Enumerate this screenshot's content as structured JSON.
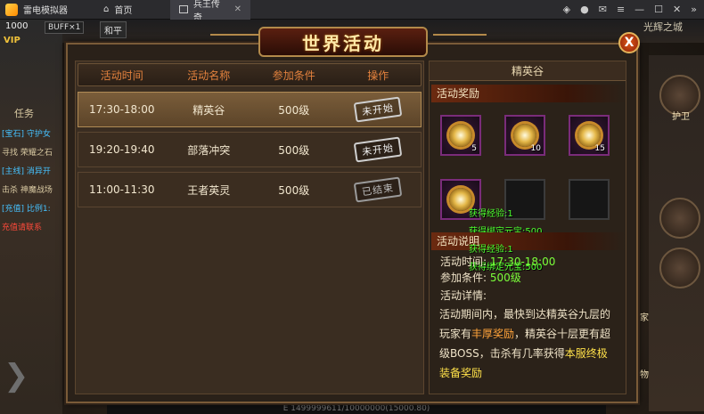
{
  "titlebar": {
    "app_name": "雷电模拟器",
    "tabs": [
      {
        "label": "首页"
      },
      {
        "label": "兵王传奇"
      }
    ],
    "icons": [
      "gamepad-icon",
      "user-icon",
      "mail-icon",
      "menu-icon",
      "minimize-icon",
      "maximize-icon",
      "close-icon",
      "expand-icon"
    ]
  },
  "hud": {
    "level": "1000",
    "vip": "VIP",
    "buff": "BUFF×1",
    "mode": "和平",
    "map_name": "光辉之城",
    "task_title": "任务",
    "task_lines": [
      {
        "text": "[宝石] 守护女",
        "color": "#46c2ff"
      },
      {
        "text": "寻找 荣耀之石",
        "color": "#d9c9a2"
      },
      {
        "text": "[主线] 消异开",
        "color": "#46c2ff"
      },
      {
        "text": "击杀 神魔战场",
        "color": "#d9c9a2"
      },
      {
        "text": "[充值] 比例1:",
        "color": "#46c2ff"
      },
      {
        "text": "充值请联系",
        "color": "#ff4a3a"
      }
    ],
    "side_labels": [
      "护卫",
      "玩家",
      "怪物"
    ],
    "bottom_text": "E 1499999611/10000000(15000.80)"
  },
  "dialog": {
    "title": "世界活动",
    "close_label": "X"
  },
  "activities": {
    "headers": [
      "活动时间",
      "活动名称",
      "参加条件",
      "操作"
    ],
    "rows": [
      {
        "time": "17:30-18:00",
        "name": "精英谷",
        "condition": "500级",
        "status": "未开始",
        "state": "pending"
      },
      {
        "time": "19:20-19:40",
        "name": "部落冲突",
        "condition": "500级",
        "status": "未开始",
        "state": "pending"
      },
      {
        "time": "11:00-11:30",
        "name": "王者英灵",
        "condition": "500级",
        "status": "已结束",
        "state": "ended"
      }
    ]
  },
  "detail": {
    "title": "精英谷",
    "reward_section": "活动奖励",
    "rewards": [
      {
        "count": "5",
        "empty": false
      },
      {
        "count": "10",
        "empty": false
      },
      {
        "count": "15",
        "empty": false
      },
      {
        "count": "",
        "empty": false
      },
      {
        "count": "",
        "empty": true
      },
      {
        "count": "",
        "empty": true
      }
    ],
    "float_texts": [
      "获得经验:1",
      "获得绑定元宝:500",
      "获得经验:1",
      "获得绑定元宝:500"
    ],
    "info_section": "活动说明",
    "time_label": "活动时间:",
    "time_value": "17:30-18:00",
    "cond_label": "参加条件:",
    "cond_value": "500级",
    "details_label": "活动详情:",
    "desc_part1": "活动期间内，最快到达精英谷九层的玩家有",
    "desc_hl1": "丰厚奖励",
    "desc_part2": "，精英谷十层更有超级BOSS，击杀有几率获得",
    "desc_hl2": "本服终极装备奖励"
  }
}
